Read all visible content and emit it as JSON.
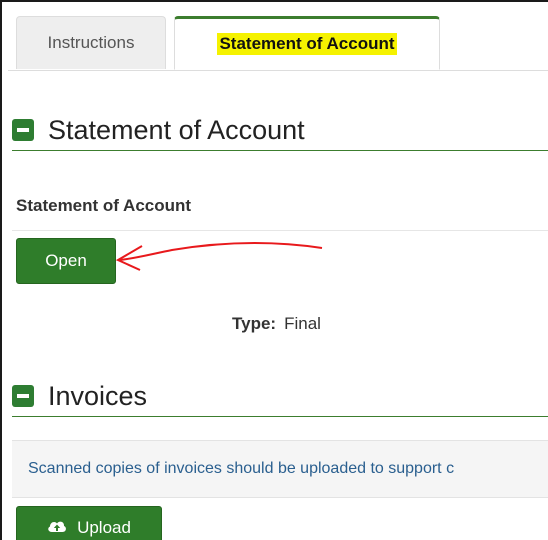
{
  "tabs": [
    {
      "label": "Instructions"
    },
    {
      "label": "Statement of Account"
    }
  ],
  "sections": {
    "statement": {
      "title": "Statement of Account",
      "subheading": "Statement of Account",
      "open_label": "Open",
      "type_label": "Type:",
      "type_value": "Final"
    },
    "invoices": {
      "title": "Invoices",
      "info_text": "Scanned copies of invoices should be uploaded to support c",
      "upload_label": "Upload"
    }
  },
  "colors": {
    "accent_green": "#2f7d2a",
    "tab_highlight": "#f5f200",
    "annotation_arrow": "#e8191c",
    "info_text": "#2a5f8f"
  },
  "icons": {
    "section_toggle": "minus-icon",
    "upload": "cloud-upload-icon"
  }
}
